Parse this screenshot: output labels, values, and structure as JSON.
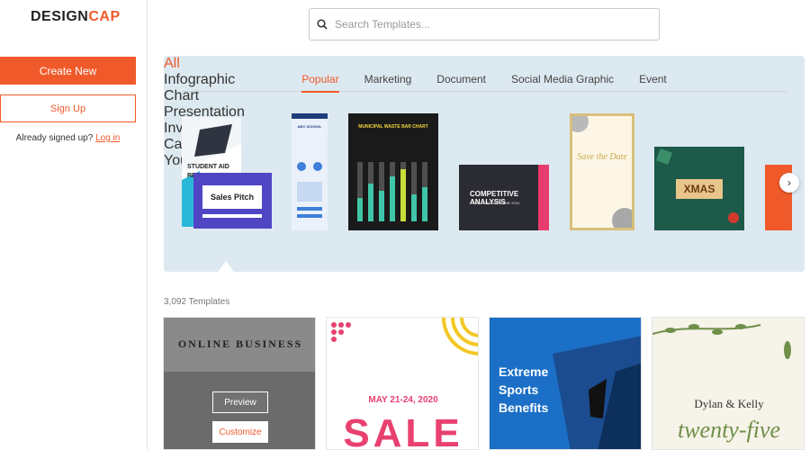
{
  "brand": {
    "name_left": "DESIGN",
    "name_right": "CAP"
  },
  "sidebar": {
    "create_label": "Create New",
    "signup_label": "Sign Up",
    "signed_text": "Already signed up?",
    "login_label": "Log in"
  },
  "search": {
    "placeholder": "Search Templates..."
  },
  "tabs": [
    {
      "label": "Popular"
    },
    {
      "label": "Marketing"
    },
    {
      "label": "Document"
    },
    {
      "label": "Social Media Graphic"
    },
    {
      "label": "Event"
    }
  ],
  "categories": [
    {
      "label": "All"
    },
    {
      "label": "Infographic"
    },
    {
      "label": "Chart"
    },
    {
      "label": "Presentation"
    },
    {
      "label": "Invitation"
    },
    {
      "label": "Card"
    },
    {
      "label": "YouT"
    }
  ],
  "thumb_text": {
    "all_a_line1": "STUDENT AID",
    "all_a_line2": "RE",
    "all_b": "Sales Pitch",
    "info_title": "ABC SCHOOL",
    "chart_title": "MUNICIPAL WASTE BAR CHART",
    "pres_title": "COMPETITIVE ANALYSIS",
    "pres_sub": "YOUR COMPANY NAME 2024",
    "invite_title": "Save the Date",
    "card_title": "XMAS"
  },
  "count_text": "3,092 Templates",
  "templates": [
    {
      "title": "ONLINE BUSINESS",
      "preview_label": "Preview",
      "customize_label": "Customize"
    },
    {
      "title": "MAY 21-24, 2020",
      "big": "SALE"
    },
    {
      "title": "Extreme Sports Benefits"
    },
    {
      "title": "Dylan & Kelly",
      "sub": "twenty-five"
    }
  ],
  "colors": {
    "accent": "#f05a2b",
    "panel": "#dde9f0"
  }
}
